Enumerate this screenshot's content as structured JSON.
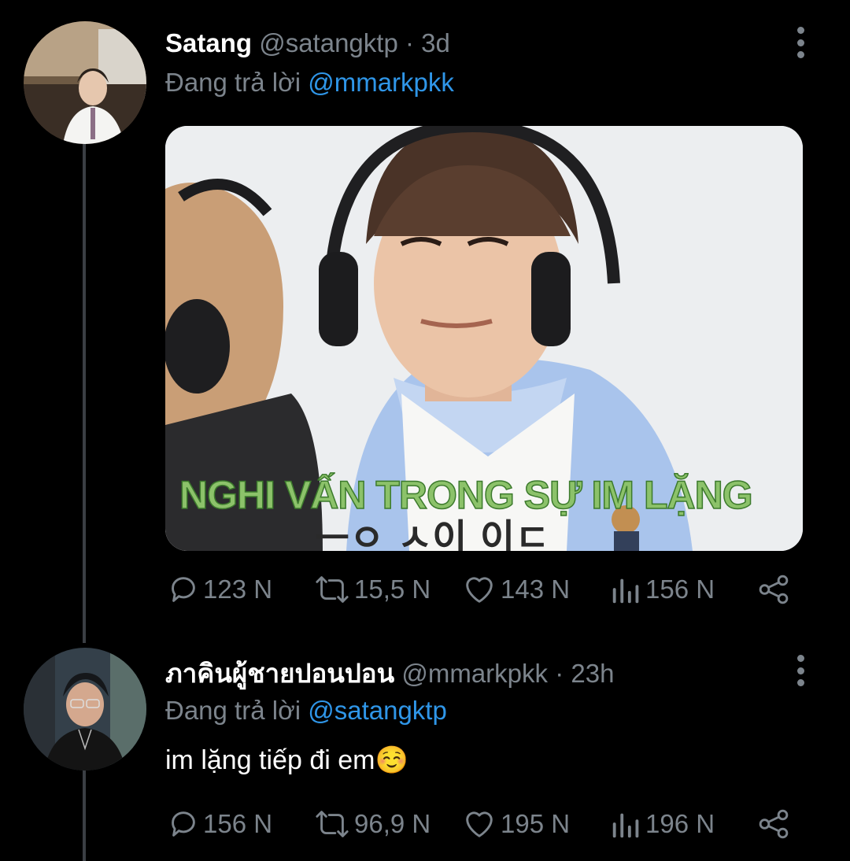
{
  "tweets": [
    {
      "name": "Satang",
      "handle": "@satangktp",
      "sep": "·",
      "time": "3d",
      "reply_prefix": "Đang trả lời",
      "reply_to": "@mmarkpkk",
      "image_caption": "NGHI VẤN TRONG SỰ IM LẶNG",
      "stats": {
        "replies": "123 N",
        "retweets": "15,5 N",
        "likes": "143 N",
        "views": "156 N"
      }
    },
    {
      "name": "ภาคินผู้ชายปอนปอน",
      "handle": "@mmarkpkk",
      "sep": "·",
      "time": "23h",
      "reply_prefix": "Đang trả lời",
      "reply_to": "@satangktp",
      "text": "im lặng tiếp đi em☺️",
      "stats": {
        "replies": "156 N",
        "retweets": "96,9 N",
        "likes": "195 N",
        "views": "196 N"
      }
    }
  ],
  "colors": {
    "background": "#000000",
    "muted": "#7c848c",
    "link": "#2f96e8",
    "text": "#e7e9ea"
  },
  "icons": [
    "reply-icon",
    "retweet-icon",
    "like-icon",
    "views-icon",
    "share-icon",
    "more-icon"
  ]
}
